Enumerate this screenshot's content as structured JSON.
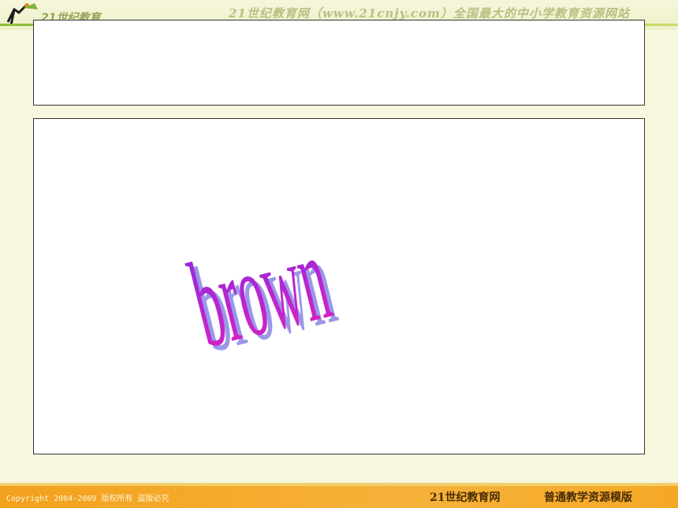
{
  "header": {
    "logo_text": "21世纪教育",
    "banner": "21世纪教育网（www.21cnjy.com）全国最大的中小学教育资源网站"
  },
  "slide": {
    "title": "",
    "word": "brown"
  },
  "footer": {
    "copyright": "Copyright 2004-2009 版权所有 盗版必究",
    "brand": "21世纪教育网",
    "tagline": "普通教学资源模版"
  },
  "colors": {
    "word_top": "#8a2be2",
    "word_bottom": "#e020c0",
    "word_shadow": "#9b97e8",
    "footer_bg": "#f5a826",
    "header_rule": "#8bbf3a"
  }
}
